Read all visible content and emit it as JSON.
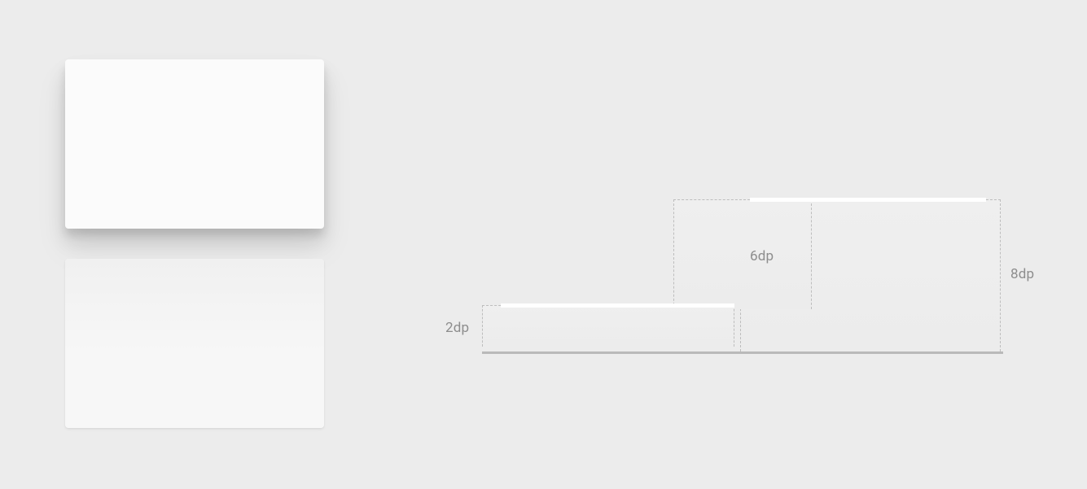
{
  "cards": {
    "elevated": {
      "elevation": "8dp"
    },
    "low": {
      "elevation": "2dp"
    }
  },
  "diagram": {
    "labels": {
      "label_2dp": "2dp",
      "label_6dp": "6dp",
      "label_8dp": "8dp"
    }
  }
}
